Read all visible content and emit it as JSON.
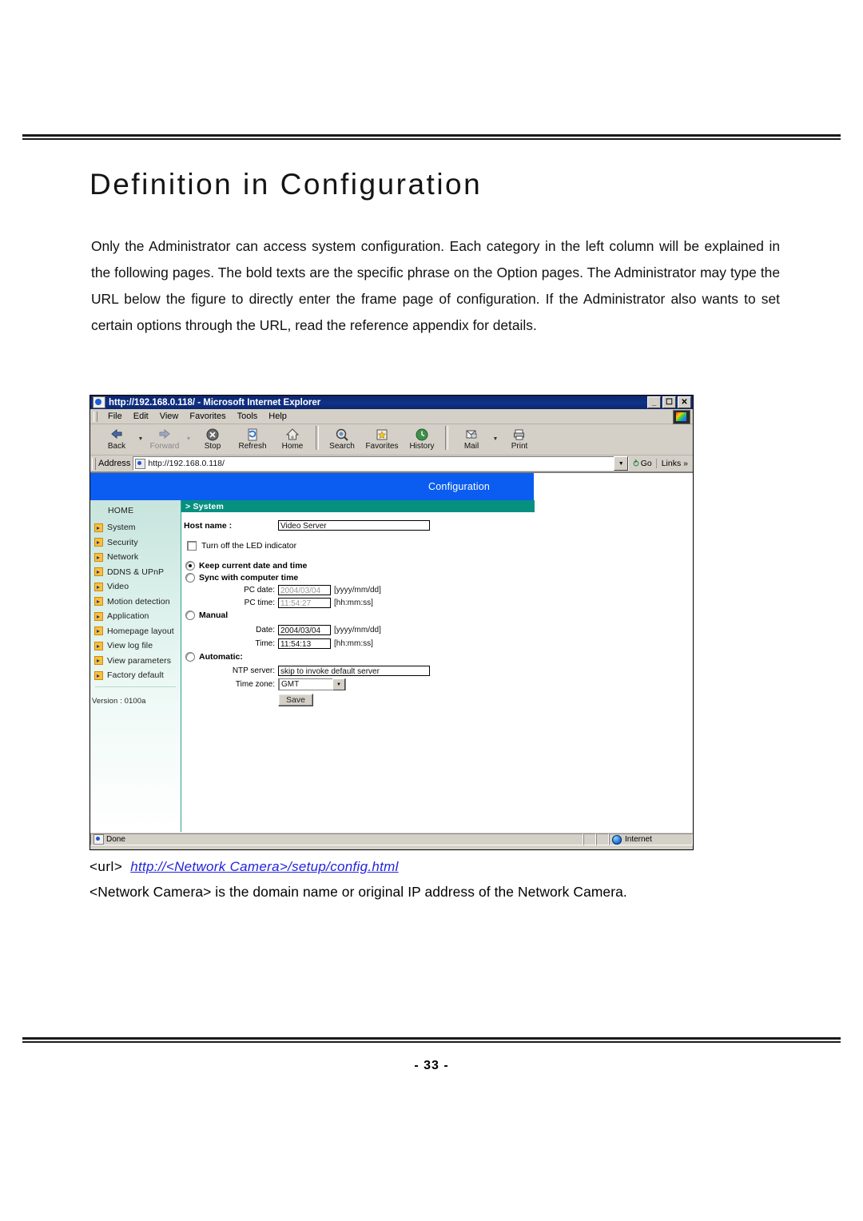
{
  "document": {
    "title": "Definition in Configuration",
    "intro": "Only the Administrator can access system configuration. Each category in the left column will be explained in the following pages. The bold texts are the specific phrase on the Option pages. The Administrator may type the URL below the figure to directly enter the frame page of configuration. If the Administrator also wants to set certain options through the URL, read the reference appendix for details.",
    "page_number": "- 33 -",
    "url_caption": {
      "tag": "<url>",
      "link": "http://<Network Camera>/setup/config.html",
      "note": "<Network Camera> is the domain name or original IP address of the Network Camera.",
      "link_color": "#2222dd"
    }
  },
  "browser": {
    "titlebar": {
      "text": "http://192.168.0.118/ - Microsoft Internet Explorer",
      "minimize": "_",
      "restore": "❐",
      "close": "✕"
    },
    "menu": [
      "File",
      "Edit",
      "View",
      "Favorites",
      "Tools",
      "Help"
    ],
    "toolbar": [
      {
        "label": "Back",
        "icon": "back-arrow-icon",
        "disabled": false,
        "dropdown": true
      },
      {
        "label": "Forward",
        "icon": "forward-arrow-icon",
        "disabled": true,
        "dropdown": true
      },
      {
        "label": "Stop",
        "icon": "stop-icon",
        "disabled": false,
        "dropdown": false
      },
      {
        "label": "Refresh",
        "icon": "refresh-icon",
        "disabled": false,
        "dropdown": false
      },
      {
        "label": "Home",
        "icon": "home-icon",
        "disabled": false,
        "dropdown": false
      },
      {
        "label": "Search",
        "icon": "search-icon",
        "disabled": false,
        "dropdown": false
      },
      {
        "label": "Favorites",
        "icon": "favorites-star-icon",
        "disabled": false,
        "dropdown": false
      },
      {
        "label": "History",
        "icon": "history-clock-icon",
        "disabled": false,
        "dropdown": false
      },
      {
        "label": "Mail",
        "icon": "mail-icon",
        "disabled": false,
        "dropdown": true
      },
      {
        "label": "Print",
        "icon": "printer-icon",
        "disabled": false,
        "dropdown": false
      }
    ],
    "address": {
      "label": "Address",
      "value": "http://192.168.0.118/",
      "go_label": "Go",
      "links_label": "Links"
    },
    "status": {
      "text": "Done",
      "zone": "Internet"
    }
  },
  "webpage": {
    "banner_title": "Configuration",
    "banner_color": "#0a5df0",
    "accent_color": "#069080",
    "sidebar": {
      "home_label": "HOME",
      "items": [
        {
          "label": "System"
        },
        {
          "label": "Security"
        },
        {
          "label": "Network"
        },
        {
          "label": "DDNS & UPnP"
        },
        {
          "label": "Video"
        },
        {
          "label": "Motion detection"
        },
        {
          "label": "Application"
        },
        {
          "label": "Homepage layout"
        },
        {
          "label": "View log file"
        },
        {
          "label": "View parameters"
        },
        {
          "label": "Factory default"
        }
      ],
      "version": "Version : 0100a"
    },
    "section_header": "> System",
    "form": {
      "host_name_label": "Host name :",
      "host_name_value": "Video Server",
      "led_checkbox_label": "Turn off the LED indicator",
      "led_checked": false,
      "time_options": [
        {
          "label": "Keep current date and time",
          "selected": true
        },
        {
          "label": "Sync with computer time",
          "selected": false
        },
        {
          "label": "Manual",
          "selected": false
        },
        {
          "label": "Automatic:",
          "selected": false
        }
      ],
      "pc_date_label": "PC date:",
      "pc_date_value": "2004/03/04",
      "pc_date_format": "[yyyy/mm/dd]",
      "pc_time_label": "PC time:",
      "pc_time_value": "11:54:27",
      "pc_time_format": "[hh:mm:ss]",
      "date_label": "Date:",
      "date_value": "2004/03/04",
      "date_format": "[yyyy/mm/dd]",
      "time_label": "Time:",
      "time_value": "11:54:13",
      "time_format": "[hh:mm:ss]",
      "ntp_label": "NTP server:",
      "ntp_value": "skip to invoke default server",
      "timezone_label": "Time zone:",
      "timezone_value": "GMT",
      "save_label": "Save"
    }
  }
}
